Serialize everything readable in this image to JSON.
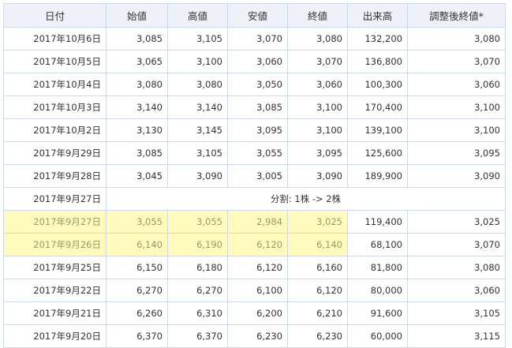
{
  "table": {
    "headers": [
      "日付",
      "始値",
      "高値",
      "安値",
      "終値",
      "出来高",
      "調整後終値*"
    ],
    "rows": [
      {
        "date": "2017年10月6日",
        "open": "3,085",
        "high": "3,105",
        "low": "3,070",
        "close": "3,080",
        "volume": "132,200",
        "adj_close": "3,080"
      },
      {
        "date": "2017年10月5日",
        "open": "3,065",
        "high": "3,100",
        "low": "3,060",
        "close": "3,070",
        "volume": "136,800",
        "adj_close": "3,070"
      },
      {
        "date": "2017年10月4日",
        "open": "3,080",
        "high": "3,080",
        "low": "3,050",
        "close": "3,060",
        "volume": "100,300",
        "adj_close": "3,060"
      },
      {
        "date": "2017年10月3日",
        "open": "3,140",
        "high": "3,140",
        "low": "3,085",
        "close": "3,100",
        "volume": "170,400",
        "adj_close": "3,100"
      },
      {
        "date": "2017年10月2日",
        "open": "3,130",
        "high": "3,145",
        "low": "3,095",
        "close": "3,100",
        "volume": "139,100",
        "adj_close": "3,100"
      },
      {
        "date": "2017年9月29日",
        "open": "3,085",
        "high": "3,105",
        "low": "3,055",
        "close": "3,095",
        "volume": "125,600",
        "adj_close": "3,095"
      },
      {
        "date": "2017年9月28日",
        "open": "3,045",
        "high": "3,090",
        "low": "3,005",
        "close": "3,090",
        "volume": "189,900",
        "adj_close": "3,090"
      },
      {
        "date": "2017年9月27日",
        "event": "分割: 1株 -> 2株"
      },
      {
        "date": "2017年9月27日",
        "open": "3,055",
        "high": "3,055",
        "low": "2,984",
        "close": "3,025",
        "volume": "119,400",
        "adj_close": "3,025",
        "highlight": true
      },
      {
        "date": "2017年9月26日",
        "open": "6,140",
        "high": "6,190",
        "low": "6,120",
        "close": "6,140",
        "volume": "68,100",
        "adj_close": "3,070",
        "highlight": true
      },
      {
        "date": "2017年9月25日",
        "open": "6,150",
        "high": "6,180",
        "low": "6,120",
        "close": "6,160",
        "volume": "81,800",
        "adj_close": "3,080"
      },
      {
        "date": "2017年9月22日",
        "open": "6,270",
        "high": "6,270",
        "low": "6,100",
        "close": "6,120",
        "volume": "80,000",
        "adj_close": "3,060"
      },
      {
        "date": "2017年9月21日",
        "open": "6,260",
        "high": "6,310",
        "low": "6,200",
        "close": "6,210",
        "volume": "91,600",
        "adj_close": "3,105"
      },
      {
        "date": "2017年9月20日",
        "open": "6,370",
        "high": "6,370",
        "low": "6,230",
        "close": "6,230",
        "volume": "60,000",
        "adj_close": "3,115"
      }
    ]
  },
  "colors": {
    "header_bg": "#eef2f8",
    "border": "#cfd8e6",
    "highlight_bg": "#fffbbc",
    "highlight_text": "#9b9b6a"
  }
}
